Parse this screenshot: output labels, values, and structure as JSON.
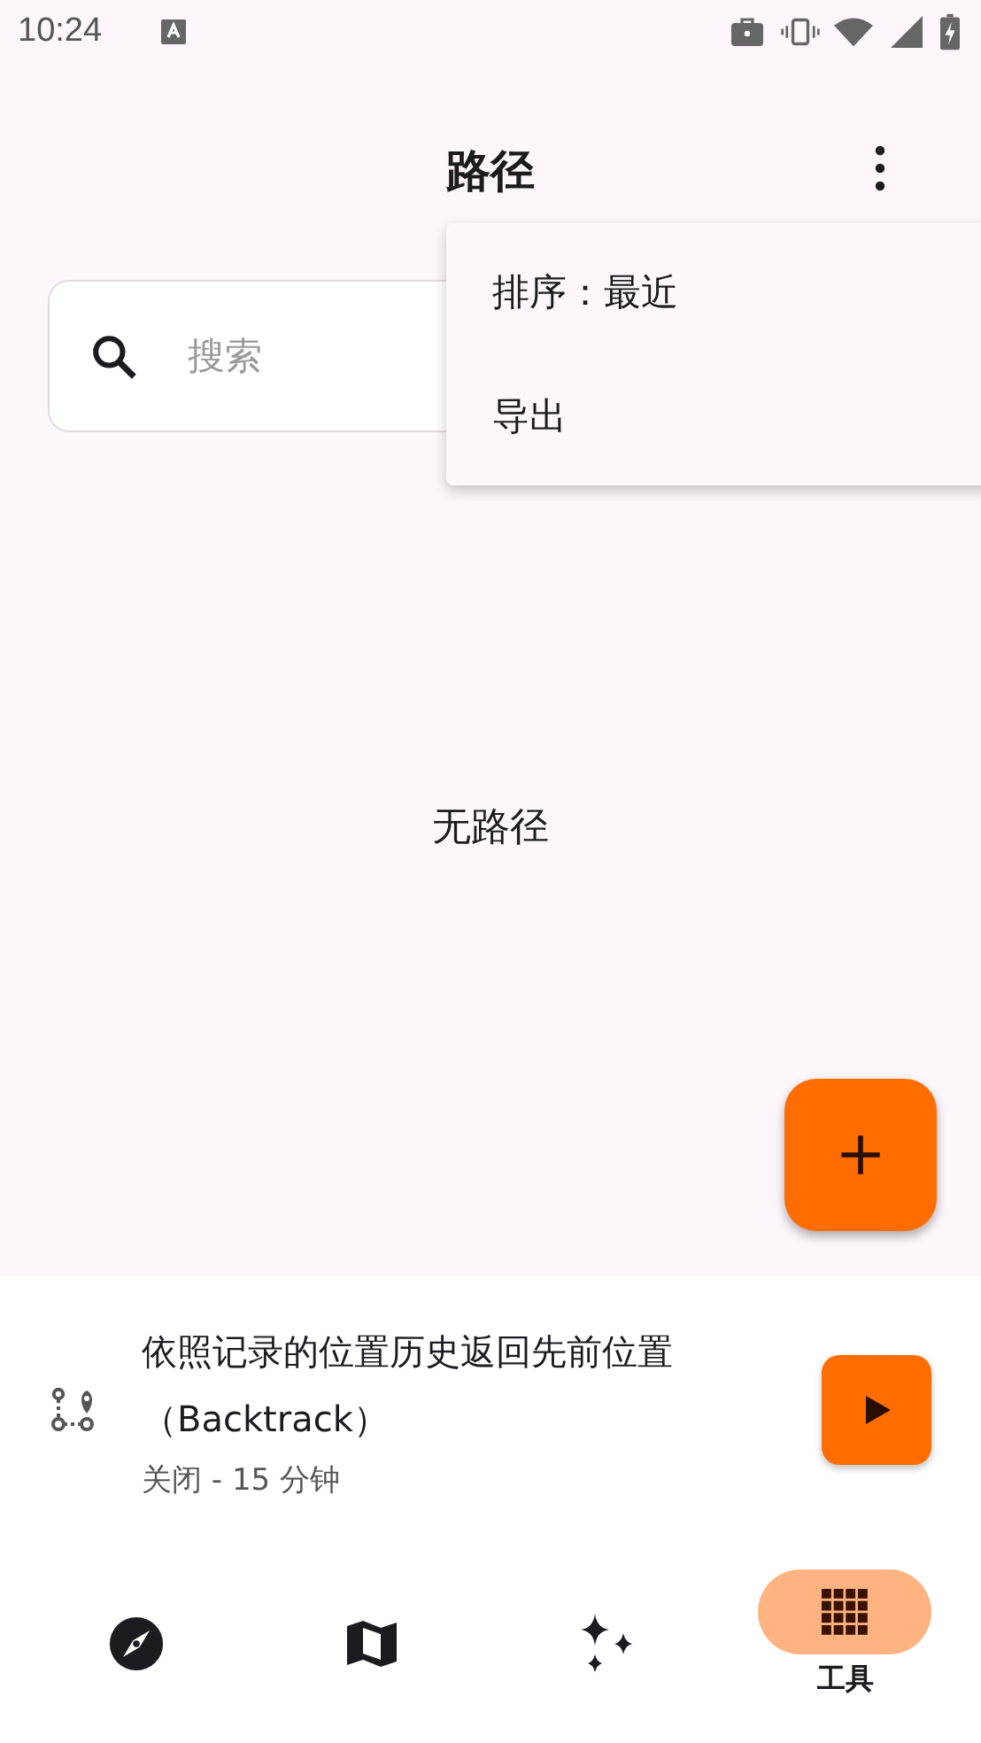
{
  "status_bar": {
    "time": "10:24"
  },
  "app_bar": {
    "title": "路径"
  },
  "search": {
    "placeholder": "搜索"
  },
  "menu": {
    "items": [
      {
        "label": "排序：最近"
      },
      {
        "label": "导出"
      }
    ]
  },
  "empty_message": "无路径",
  "backtrack": {
    "title": "依照记录的位置历史返回先前位置（Backtrack）",
    "subtitle": "关闭 - 15 分钟"
  },
  "nav": [
    {
      "kind": "compass",
      "selected": false
    },
    {
      "kind": "map",
      "selected": false
    },
    {
      "kind": "sparkles",
      "selected": false
    },
    {
      "kind": "grid",
      "selected": true,
      "label": "工具"
    }
  ]
}
